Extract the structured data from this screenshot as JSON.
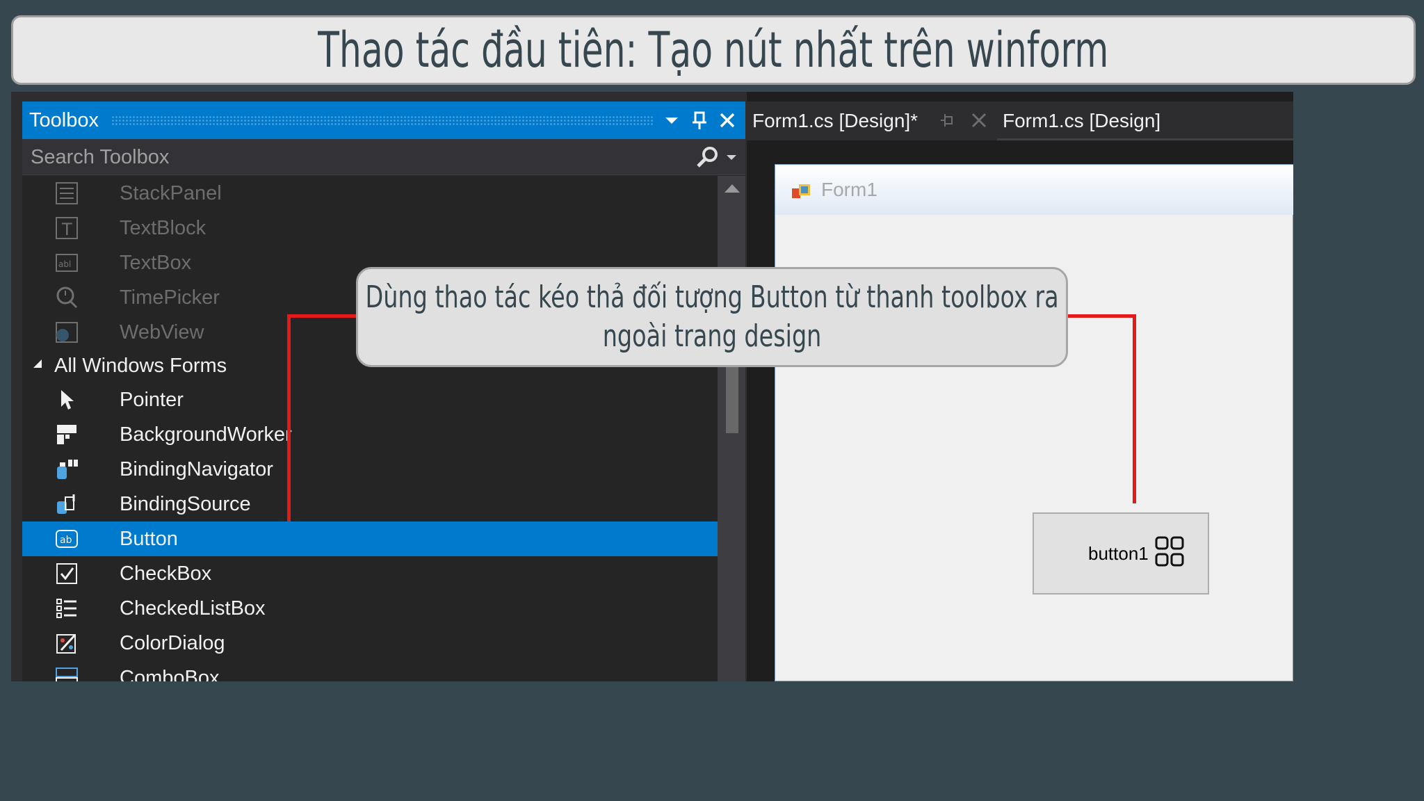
{
  "slide": {
    "title": "Thao tác đầu tiên: Tạo nút nhất trên winform",
    "callout_line1": "Dùng thao tác kéo thả đối tượng Button từ thanh toolbox ra",
    "callout_line2": "ngoài trang design",
    "connector_color": "#e21a1a"
  },
  "toolbox": {
    "title": "Toolbox",
    "search_placeholder": "Search Toolbox",
    "items": [
      {
        "label": "StackPanel",
        "icon": "stackpanel-icon",
        "state": "dim"
      },
      {
        "label": "TextBlock",
        "icon": "textblock-icon",
        "state": "dim"
      },
      {
        "label": "TextBox",
        "icon": "textbox-icon",
        "state": "dim"
      },
      {
        "label": "TimePicker",
        "icon": "timepicker-icon",
        "state": "dim"
      },
      {
        "label": "WebView",
        "icon": "webview-icon",
        "state": "dim"
      },
      {
        "label": "All Windows Forms",
        "icon": "collapse-arrow-icon",
        "state": "category"
      },
      {
        "label": "Pointer",
        "icon": "pointer-icon",
        "state": "normal"
      },
      {
        "label": "BackgroundWorker",
        "icon": "backgroundworker-icon",
        "state": "normal"
      },
      {
        "label": "BindingNavigator",
        "icon": "bindingnavigator-icon",
        "state": "normal"
      },
      {
        "label": "BindingSource",
        "icon": "bindingsource-icon",
        "state": "normal"
      },
      {
        "label": "Button",
        "icon": "button-icon",
        "state": "selected"
      },
      {
        "label": "CheckBox",
        "icon": "checkbox-icon",
        "state": "normal"
      },
      {
        "label": "CheckedListBox",
        "icon": "checkedlistbox-icon",
        "state": "normal"
      },
      {
        "label": "ColorDialog",
        "icon": "colordialog-icon",
        "state": "normal"
      },
      {
        "label": "ComboBox",
        "icon": "combobox-icon",
        "state": "normal"
      }
    ],
    "accent_color": "#007acc"
  },
  "designer": {
    "tab_active": "Form1.cs [Design]*",
    "tab_other": "Form1.cs [Design]",
    "form_title": "Form1",
    "button_label": "button1"
  }
}
